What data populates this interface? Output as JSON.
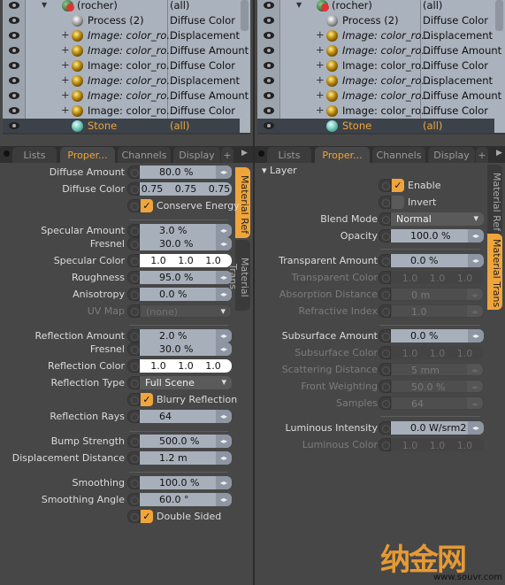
{
  "colors": {
    "accent": "#f0a53a",
    "outliner_bg": "#aab2bd",
    "panel_bg": "#474747"
  },
  "outliner": {
    "rows": [
      {
        "name": "(rocher)",
        "type": "(all)",
        "italic": false,
        "icon": "group-material-icon",
        "expander": "triangle"
      },
      {
        "name": "Process (2)",
        "type": "Diffuse Color",
        "italic": false,
        "icon": "process-icon",
        "expander": ""
      },
      {
        "name": "Image: color_ro...",
        "type": "Displacement",
        "italic": true,
        "icon": "image-texture-icon",
        "expander": "+"
      },
      {
        "name": "Image: color_ro...",
        "type": "Diffuse Amount",
        "italic": true,
        "icon": "image-texture-icon",
        "expander": "+"
      },
      {
        "name": "Image: color_ro...",
        "type": "Diffuse Color",
        "italic": false,
        "icon": "image-texture-icon",
        "expander": "+"
      },
      {
        "name": "Image: color_ro...",
        "type": "Displacement",
        "italic": true,
        "icon": "image-texture-icon",
        "expander": "+"
      },
      {
        "name": "Image: color_ro...",
        "type": "Diffuse Amount",
        "italic": true,
        "icon": "image-texture-icon",
        "expander": "+"
      },
      {
        "name": "Image: color_ro...",
        "type": "Diffuse Color",
        "italic": false,
        "icon": "image-texture-icon",
        "expander": "+"
      },
      {
        "name": "Stone",
        "type": "(all)",
        "italic": false,
        "icon": "material-icon",
        "expander": "",
        "selected": true
      }
    ]
  },
  "tabs": [
    {
      "label": "Lists"
    },
    {
      "label": "Proper...",
      "active": true
    },
    {
      "label": "Channels"
    },
    {
      "label": "Display"
    },
    {
      "label": "+"
    }
  ],
  "left": {
    "vtabs": [
      {
        "label": "Material Ref",
        "active": true
      },
      {
        "label": "Material Trans"
      }
    ],
    "rows": [
      {
        "label": "Diffuse Amount",
        "type": "num",
        "value": "80.0 %"
      },
      {
        "label": "Diffuse Color",
        "type": "color",
        "value": "0.75 0.75 0.75",
        "grey": true
      },
      {
        "label": "",
        "type": "check",
        "value": "Conserve Energy",
        "checked": true
      },
      {
        "label": "Specular Amount",
        "type": "num",
        "value": "3.0 %"
      },
      {
        "label": "Fresnel",
        "type": "num",
        "value": "30.0 %"
      },
      {
        "label": "Specular Color",
        "type": "color",
        "value": "1.0 1.0 1.0"
      },
      {
        "label": "Roughness",
        "type": "num",
        "value": "95.0 %"
      },
      {
        "label": "Anisotropy",
        "type": "num",
        "value": "0.0 %"
      },
      {
        "label": "UV Map",
        "type": "select",
        "value": "(none)",
        "disabled": true
      },
      {
        "label": "Reflection Amount",
        "type": "num",
        "value": "2.0 %"
      },
      {
        "label": "Fresnel",
        "type": "num",
        "value": "30.0 %"
      },
      {
        "label": "Reflection Color",
        "type": "color",
        "value": "1.0 1.0 1.0"
      },
      {
        "label": "Reflection Type",
        "type": "select",
        "value": "Full Scene"
      },
      {
        "label": "",
        "type": "check",
        "value": "Blurry Reflection",
        "checked": true
      },
      {
        "label": "Reflection Rays",
        "type": "num",
        "value": "64"
      },
      {
        "label": "Bump Strength",
        "type": "num",
        "value": "500.0 %"
      },
      {
        "label": "Displacement Distance",
        "type": "num",
        "value": "1.2 m"
      },
      {
        "label": "Smoothing",
        "type": "num",
        "value": "100.0 %"
      },
      {
        "label": "Smoothing Angle",
        "type": "num",
        "value": "60.0 °"
      },
      {
        "label": "",
        "type": "check",
        "value": "Double Sided",
        "checked": true
      }
    ]
  },
  "right": {
    "section": "Layer",
    "vtabs": [
      {
        "label": "Material Ref"
      },
      {
        "label": "Material Trans",
        "active": true
      }
    ],
    "rows": [
      {
        "label": "",
        "type": "check",
        "value": "Enable",
        "checked": true
      },
      {
        "label": "",
        "type": "check",
        "value": "Invert",
        "checked": false
      },
      {
        "label": "Blend Mode",
        "type": "select",
        "value": "Normal"
      },
      {
        "label": "Opacity",
        "type": "num",
        "value": "100.0 %"
      },
      {
        "label": "Transparent Amount",
        "type": "num",
        "value": "0.0 %"
      },
      {
        "label": "Transparent Color",
        "type": "color",
        "value": "1.0 1.0 1.0",
        "disabled": true
      },
      {
        "label": "Absorption Distance",
        "type": "num",
        "value": "0 m",
        "disabled": true
      },
      {
        "label": "Refractive Index",
        "type": "num",
        "value": "1.0",
        "disabled": true
      },
      {
        "label": "Subsurface Amount",
        "type": "num",
        "value": "0.0 %"
      },
      {
        "label": "Subsurface Color",
        "type": "color",
        "value": "1.0 1.0 1.0",
        "disabled": true
      },
      {
        "label": "Scattering Distance",
        "type": "num",
        "value": "5 mm",
        "disabled": true
      },
      {
        "label": "Front Weighting",
        "type": "num",
        "value": "50.0 %",
        "disabled": true
      },
      {
        "label": "Samples",
        "type": "num",
        "value": "64",
        "disabled": true
      },
      {
        "label": "Luminous Intensity",
        "type": "num",
        "value": "0.0 W/srm2"
      },
      {
        "label": "Luminous Color",
        "type": "color",
        "value": "1.0 1.0 1.0",
        "disabled": true
      }
    ]
  },
  "watermark": {
    "logo": "纳金网",
    "url": "www.souvr.com"
  }
}
